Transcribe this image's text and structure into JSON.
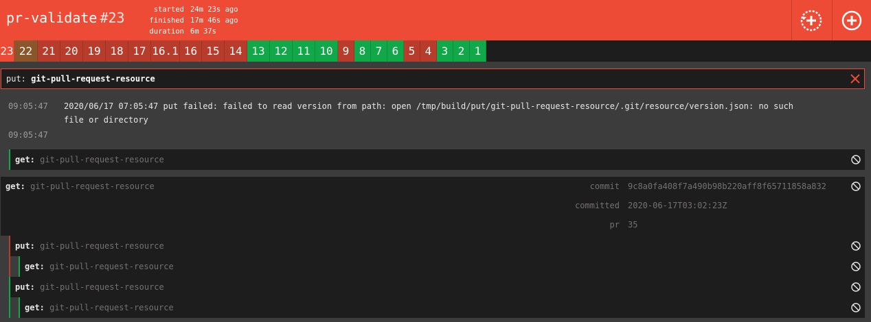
{
  "header": {
    "pipeline_name": "pr-validate",
    "build_number": "#23",
    "timing": [
      {
        "label": "started",
        "value": "24m 23s ago"
      },
      {
        "label": "finished",
        "value": "17m 46s ago"
      },
      {
        "label": "duration",
        "value": "6m 37s"
      }
    ],
    "buttons": [
      "rerun-build-icon",
      "trigger-build-icon"
    ]
  },
  "history": [
    {
      "label": "23",
      "status": "failed-current"
    },
    {
      "label": "22",
      "status": "aborted"
    },
    {
      "label": "21",
      "status": "failed"
    },
    {
      "label": "20",
      "status": "failed"
    },
    {
      "label": "19",
      "status": "failed"
    },
    {
      "label": "18",
      "status": "failed"
    },
    {
      "label": "17",
      "status": "failed"
    },
    {
      "label": "16.1",
      "status": "failed"
    },
    {
      "label": "16",
      "status": "failed"
    },
    {
      "label": "15",
      "status": "failed"
    },
    {
      "label": "14",
      "status": "failed"
    },
    {
      "label": "13",
      "status": "succeeded"
    },
    {
      "label": "12",
      "status": "succeeded"
    },
    {
      "label": "11",
      "status": "succeeded"
    },
    {
      "label": "10",
      "status": "succeeded"
    },
    {
      "label": "9",
      "status": "failed"
    },
    {
      "label": "8",
      "status": "succeeded"
    },
    {
      "label": "7",
      "status": "succeeded"
    },
    {
      "label": "6",
      "status": "succeeded"
    },
    {
      "label": "5",
      "status": "failed"
    },
    {
      "label": "4",
      "status": "failed"
    },
    {
      "label": "3",
      "status": "succeeded"
    },
    {
      "label": "2",
      "status": "succeeded"
    },
    {
      "label": "1",
      "status": "succeeded"
    }
  ],
  "steps": {
    "put_main": {
      "type": "put:",
      "resource": "git-pull-request-resource"
    },
    "logs": [
      {
        "time": "09:05:47",
        "message": "2020/06/17 07:05:47 put failed: failed to read version from path: open /tmp/build/put/git-pull-request-resource/.git/resource/version.json: no such file or directory"
      },
      {
        "time": "09:05:47",
        "message": ""
      }
    ],
    "get_child": {
      "type": "get:",
      "resource": "git-pull-request-resource"
    },
    "get_main": {
      "type": "get:",
      "resource": "git-pull-request-resource",
      "metadata": [
        {
          "key": "commit",
          "value": "9c8a0fa408f7a490b98b220aff8f65711858a832"
        },
        {
          "key": "committed",
          "value": "2020-06-17T03:02:23Z"
        },
        {
          "key": "pr",
          "value": "35"
        }
      ]
    },
    "nested": [
      {
        "type": "put:",
        "resource": "git-pull-request-resource"
      },
      {
        "type": "get:",
        "resource": "git-pull-request-resource"
      },
      {
        "type": "put:",
        "resource": "git-pull-request-resource"
      },
      {
        "type": "get:",
        "resource": "git-pull-request-resource"
      }
    ]
  },
  "colors": {
    "failed": "#ed4b35",
    "succeeded": "#11a84a",
    "aborted": "#8b572a"
  }
}
